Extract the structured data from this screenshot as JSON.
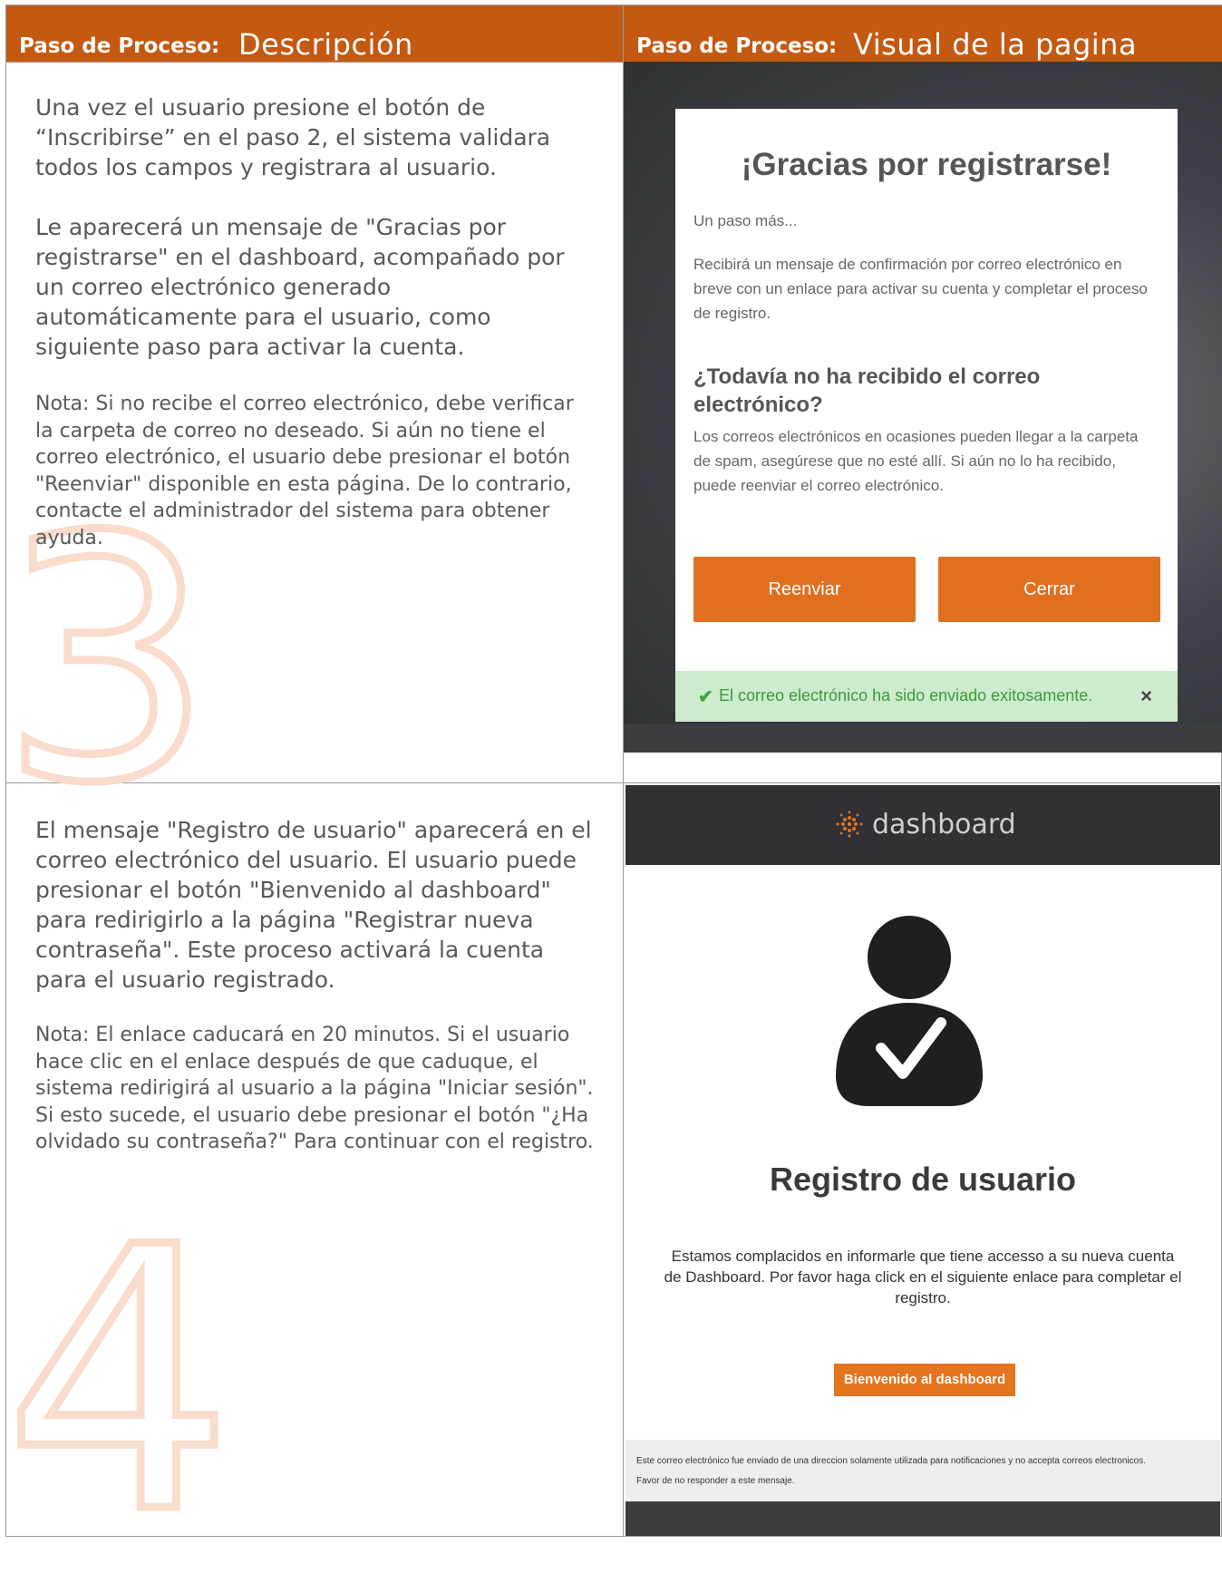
{
  "headers": {
    "left_label": "Paso de Proceso:",
    "left_title": "Descripción",
    "right_label": "Paso de Proceso:",
    "right_title": "Visual de la pagina"
  },
  "step3": {
    "number": "3",
    "para1": "Una vez el usuario presione el botón de “Inscribirse” en el paso 2, el sistema validara todos los campos y registrara al usuario.",
    "para2": "Le aparecerá un mensaje de \"Gracias por registrarse\" en el dashboard, acompañado por un correo electrónico generado automáticamente para el usuario, como siguiente paso para activar la cuenta.",
    "note": "Nota: Si no recibe el correo electrónico, debe verificar la carpeta de correo no deseado. Si aún no tiene el correo electrónico, el usuario debe presionar el botón \"Reenviar\" disponible en esta página. De lo contrario, contacte el administrador del sistema para obtener ayuda.",
    "visual": {
      "title": "¡Gracias por registrarse!",
      "subtitle": "Un paso más...",
      "body": "Recibirá un mensaje de confirmación por correo electrónico en breve con un enlace para activar su cuenta y completar el proceso de registro.",
      "question": "¿Todavía no ha recibido el correo electrónico?",
      "hint": "Los correos electrónicos en ocasiones pueden llegar a la carpeta de spam, asegúrese que no esté allí. Si aún no lo ha recibido, puede reenviar el correo electrónico.",
      "resend_button": "Reenviar",
      "close_button": "Cerrar",
      "alert_icon": "check-icon",
      "alert": "El correo electrónico ha sido enviado exitosamente.",
      "alert_close": "×",
      "button_color": "#e07020",
      "alert_color": "#cdeccd"
    }
  },
  "step4": {
    "number": "4",
    "para1": "El mensaje \"Registro de usuario\" aparecerá en el correo electrónico del usuario. El usuario puede presionar el botón \"Bienvenido al dashboard\" para redirigirlo a la página \"Registrar nueva contraseña\". Este proceso activará la cuenta para el usuario registrado.",
    "note": "Nota:  El enlace caducará en 20 minutos. Si el usuario hace clic en el enlace después de que caduque, el sistema redirigirá al usuario a la página \"Iniciar sesión\". Si esto sucede, el usuario debe presionar el botón \"¿Ha olvidado su contraseña?\" Para continuar con el registro.",
    "visual": {
      "brand": "dashboard",
      "icon": "user-check-icon",
      "title": "Registro de usuario",
      "body": "Estamos complacidos en informarle que tiene accesso a su nueva cuenta de Dashboard. Por favor haga click en el siguiente enlace para completar el registro.",
      "button": "Bienvenido al dashboard",
      "footer1": "Este correo electrónico fue enviado de una direccion solamente utilizada para notificaciones y no accepta correos electronicos.",
      "footer2": "Favor de no responder a este mensaje."
    }
  },
  "colors": {
    "header": "#c45911",
    "step_number": "#f9dccb",
    "body_text": "#595959"
  }
}
